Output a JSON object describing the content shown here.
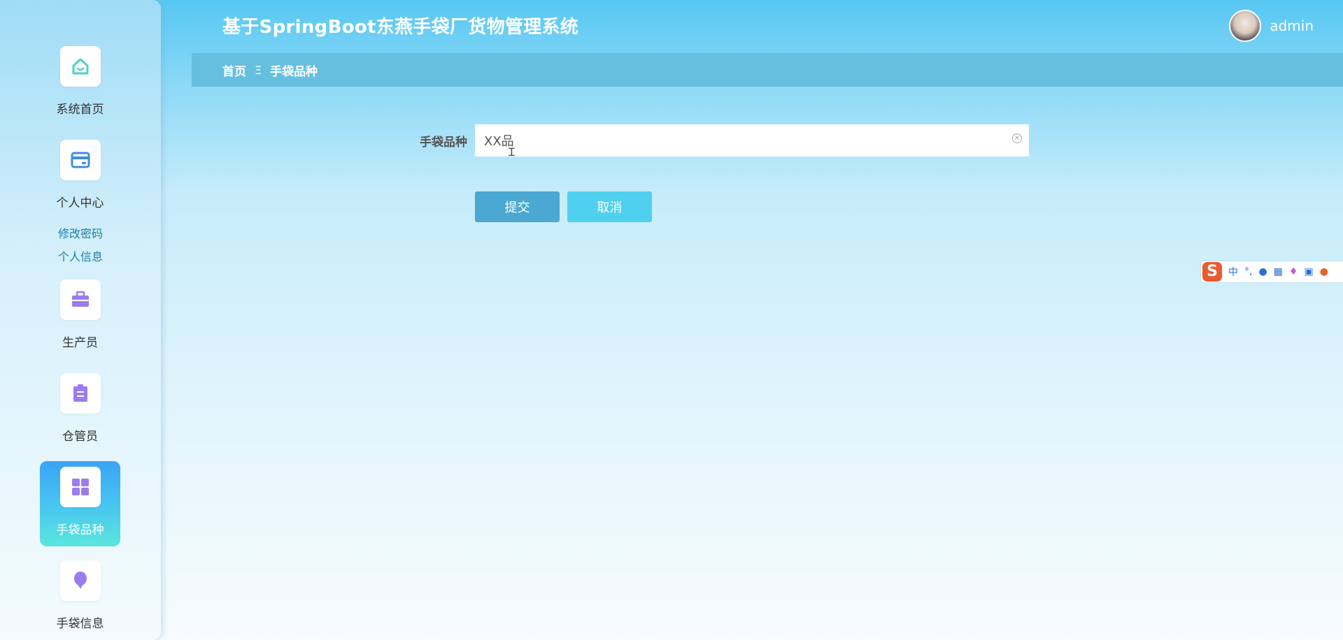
{
  "app": {
    "title": "基于SpringBoot东燕手袋厂货物管理系统",
    "username": "admin"
  },
  "sidebar": {
    "items": [
      {
        "label": "系统首页",
        "icon": "home-icon"
      },
      {
        "label": "个人中心",
        "icon": "wallet-icon"
      },
      {
        "label": "生产员",
        "icon": "briefcase-icon"
      },
      {
        "label": "仓管员",
        "icon": "clipboard-icon"
      },
      {
        "label": "手袋品种",
        "icon": "grid-icon",
        "active": true
      },
      {
        "label": "手袋信息",
        "icon": "lightbulb-icon"
      }
    ],
    "sub_links": [
      "修改密码",
      "个人信息"
    ]
  },
  "breadcrumb": {
    "home": "首页",
    "separator": "Ξ",
    "current": "手袋品种"
  },
  "form": {
    "field_label": "手袋品种",
    "field_value": "XX品"
  },
  "buttons": {
    "submit": "提交",
    "cancel": "取消"
  },
  "ime": {
    "logo": "S",
    "mode": "中"
  },
  "colors": {
    "icon_teal": "#4fd1c5",
    "icon_blue": "#3c8dde",
    "icon_purple": "#9b7cf0",
    "active_gradient_top": "#3aa4f5",
    "active_gradient_bottom": "#5ae6dc"
  }
}
